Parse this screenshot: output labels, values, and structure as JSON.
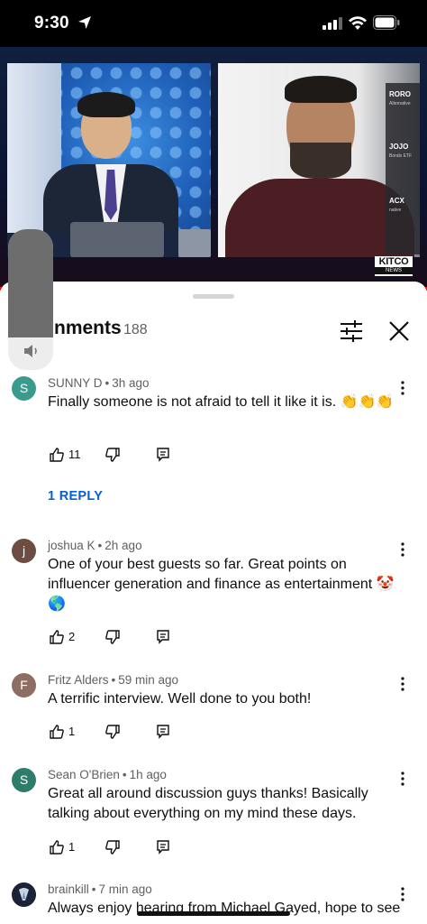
{
  "status_bar": {
    "time": "9:30",
    "location_icon": "location-arrow-icon",
    "signal_icon": "cellular-signal-icon",
    "wifi_icon": "wifi-icon",
    "battery_icon": "battery-icon"
  },
  "video": {
    "network_logo_text": "KITCO",
    "network_logo_sub": "NEWS",
    "ticker_items": [
      {
        "symbol": "RORO",
        "desc": "Alternative"
      },
      {
        "symbol": "JOJO",
        "desc": "Bonds ETF"
      },
      {
        "symbol": "ACX",
        "desc": "native"
      }
    ],
    "progress_fraction": 1.0,
    "progress_color": "#ff0000"
  },
  "comments_panel": {
    "title": "Comments",
    "title_visible_fragment": "nments",
    "count": "188",
    "filter_icon": "sliders-icon",
    "close_icon": "close-icon",
    "volume_icon": "speaker-icon"
  },
  "comments": [
    {
      "author": "SUNNY D",
      "time": "3h ago",
      "initial": "S",
      "avatar_color": "#3a9a8e",
      "text": "Finally someone is not afraid to tell it like it is. 👏👏👏",
      "likes": "11",
      "replies_label": "1 REPLY"
    },
    {
      "author": "joshua K",
      "time": "2h ago",
      "initial": "j",
      "avatar_color": "#6d4c41",
      "text": "One of your best guests so far. Great points on influencer generation and finance as entertainment 🤡🌎",
      "likes": "2"
    },
    {
      "author": "Fritz Alders",
      "time": "59 min ago",
      "initial": "F",
      "avatar_color": "#8d6e63",
      "text": "A terrific interview. Well done to you both!",
      "likes": "1"
    },
    {
      "author": "Sean O'Brien",
      "time": "1h ago",
      "initial": "S",
      "avatar_color": "#2e7d6b",
      "text": "Great all around discussion guys thanks! Basically talking about everything on my mind these days.",
      "likes": "1"
    },
    {
      "author": "brainkill",
      "time": "7 min ago",
      "initial": "",
      "avatar_color": "#1c2338",
      "text": "Always enjoy hearing from Michael Gayed, hope to see"
    }
  ],
  "icons": {
    "like": "thumbs-up-icon",
    "dislike": "thumbs-down-icon",
    "reply": "reply-icon",
    "more": "more-vertical-icon"
  },
  "colors": {
    "link_blue": "#065fd4",
    "meta_gray": "#606060",
    "text": "#0f0f0f"
  }
}
